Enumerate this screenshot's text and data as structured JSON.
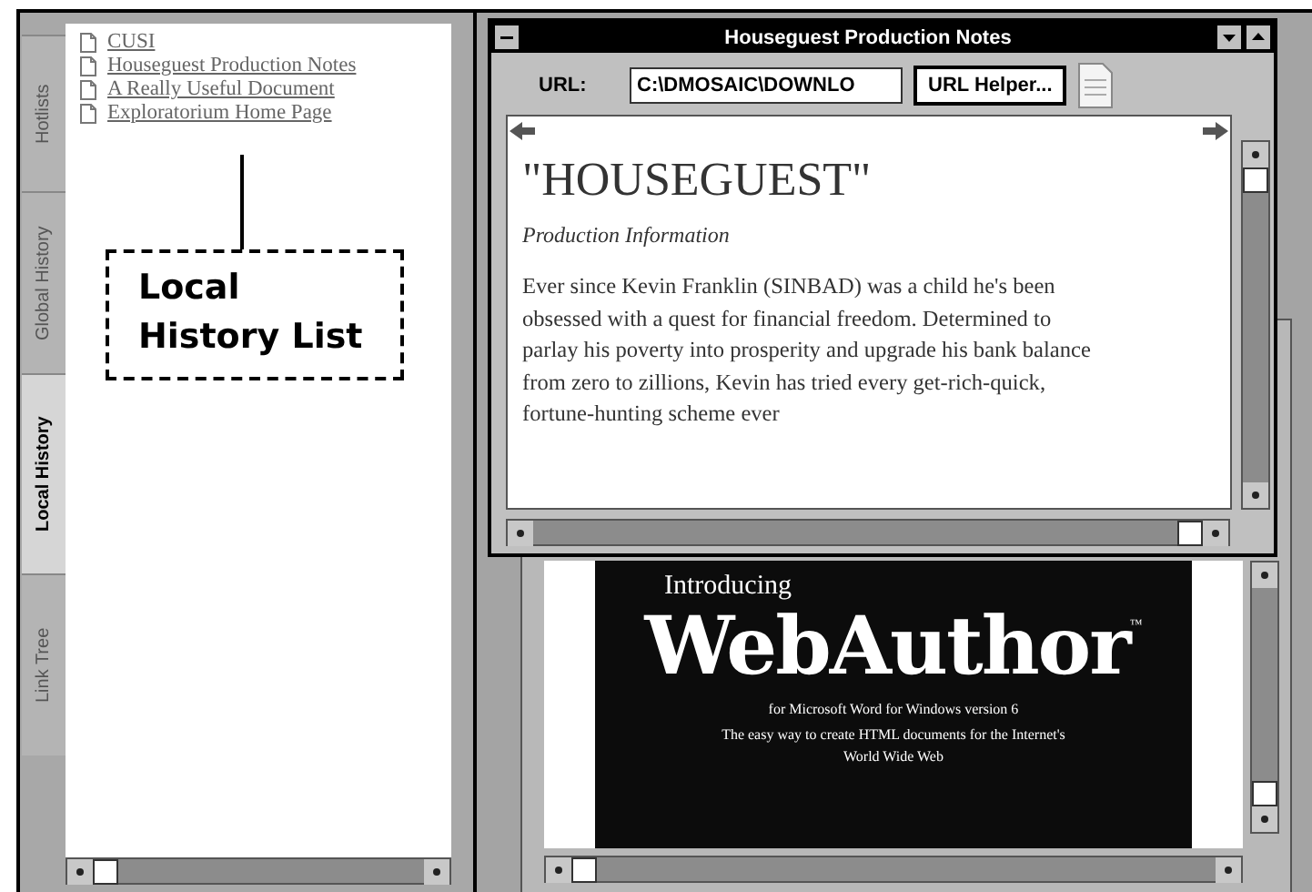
{
  "sidebar": {
    "tabs": [
      {
        "label": "Hotlists",
        "selected": false
      },
      {
        "label": "Global History",
        "selected": false
      },
      {
        "label": "Local History",
        "selected": true
      },
      {
        "label": "Link Tree",
        "selected": false
      }
    ],
    "history_items": [
      {
        "label": "CUSI"
      },
      {
        "label": "Houseguest Production Notes"
      },
      {
        "label": "A Really Useful Document"
      },
      {
        "label": "Exploratorium Home Page"
      }
    ]
  },
  "callout": {
    "text": "Local History List"
  },
  "document_window": {
    "title": "Houseguest Production Notes",
    "url_label": "URL:",
    "url_value": "C:\\DMOSAIC\\DOWNLO",
    "url_helper_button": "URL Helper...",
    "heading": "\"HOUSEGUEST\"",
    "subheading": "Production Information",
    "body": "Ever since Kevin Franklin (SINBAD) was a child he's been obsessed with a quest for financial freedom. Determined to parlay his poverty into prosperity and upgrade his bank balance from zero to zillions, Kevin has tried every get-rich-quick, fortune-hunting scheme ever"
  },
  "background_window": {
    "banner": {
      "intro": "Introducing",
      "product": "WebAuthor",
      "trademark": "™",
      "subtitle": "for Microsoft Word for Windows version 6",
      "tagline": "The easy way to create HTML documents for the Internet's World Wide Web"
    }
  }
}
